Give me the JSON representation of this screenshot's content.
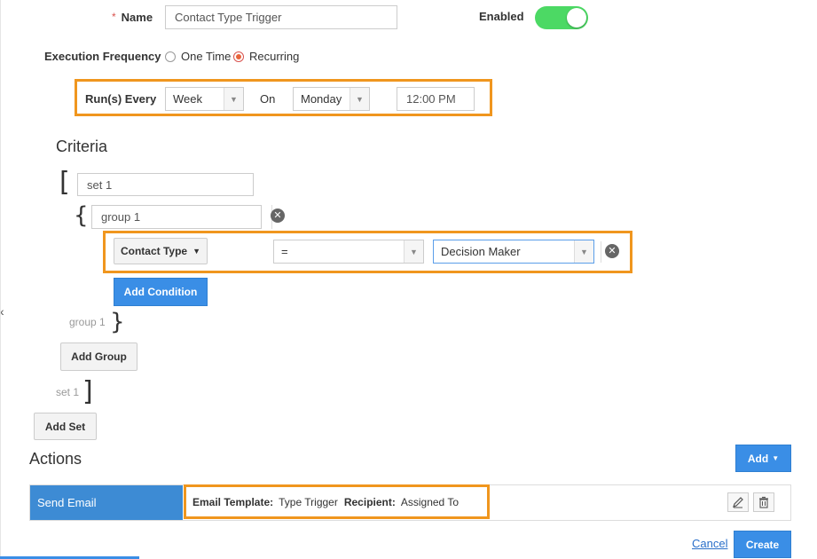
{
  "name_field": {
    "required_mark": "*",
    "label": "Name",
    "value": "Contact Type Trigger"
  },
  "enabled": {
    "label": "Enabled",
    "on": true
  },
  "execution_frequency": {
    "label": "Execution Frequency",
    "options": [
      {
        "label": "One Time",
        "selected": false
      },
      {
        "label": "Recurring",
        "selected": true
      }
    ]
  },
  "runs_every": {
    "label": "Run(s) Every",
    "period": "Week",
    "on_label": "On",
    "day": "Monday",
    "time": "12:00 PM"
  },
  "criteria": {
    "title": "Criteria",
    "set": {
      "name": "set 1",
      "footer": "set 1",
      "open_bracket": "[",
      "close_bracket": "]"
    },
    "group": {
      "name": "group 1",
      "footer": "group 1",
      "open_brace": "{",
      "close_brace": "}"
    },
    "condition": {
      "field": "Contact Type",
      "operator": "=",
      "value": "Decision Maker"
    },
    "add_condition_label": "Add Condition",
    "add_group_label": "Add Group",
    "add_set_label": "Add Set"
  },
  "actions": {
    "title": "Actions",
    "add_label": "Add",
    "rows": [
      {
        "type": "Send Email",
        "template_label": "Email Template:",
        "template_value": "Type Trigger",
        "recipient_label": "Recipient:",
        "recipient_value": "Assigned To"
      }
    ]
  },
  "footer": {
    "cancel_label": "Cancel",
    "create_label": "Create"
  },
  "colors": {
    "accent": "#3a8ee6",
    "highlight": "#f0961e",
    "toggle_on": "#4cd964",
    "action_row": "#3d8bd4"
  },
  "icons": {
    "remove": "close-circle-icon",
    "edit": "pencil-icon",
    "delete": "trash-icon",
    "dropdown": "caret-down-icon"
  }
}
